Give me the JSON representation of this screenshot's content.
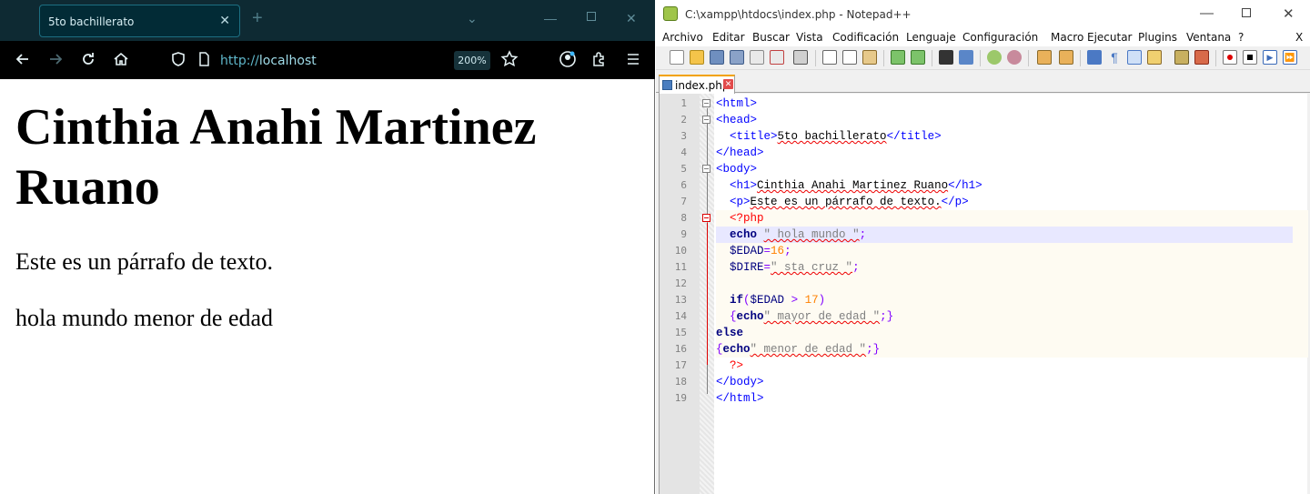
{
  "browser": {
    "tab_title": "5to bachillerato",
    "url_prefix": "http://",
    "url_host": "localhost",
    "zoom": "200%",
    "page": {
      "h1": "Cinthia Anahi Martinez Ruano",
      "paragraph": "Este es un párrafo de texto.",
      "output": "hola mundo menor de edad"
    }
  },
  "notepad": {
    "title": "C:\\xampp\\htdocs\\index.php - Notepad++",
    "menu": [
      "Archivo",
      "Editar",
      "Buscar",
      "Vista",
      "Codificación",
      "Lenguaje",
      "Configuración",
      "Macro",
      "Ejecutar",
      "Plugins",
      "Ventana",
      "?",
      "X"
    ],
    "file_tab": "index.php",
    "line_numbers": [
      "1",
      "2",
      "3",
      "4",
      "5",
      "6",
      "7",
      "8",
      "9",
      "10",
      "11",
      "12",
      "13",
      "14",
      "15",
      "16",
      "17",
      "18",
      "19"
    ],
    "code": {
      "l1": "<html>",
      "l2": "<head>",
      "l3_open": "<title>",
      "l3_text": "5to bachillerato",
      "l3_close": "</title>",
      "l4": "</head>",
      "l5": "<body>",
      "l6_open": "<h1>",
      "l6_text": "Cinthia Anahi Martinez Ruano",
      "l6_close": "</h1>",
      "l7_open": "<p>",
      "l7_text": "Este es un párrafo de texto.",
      "l7_close": "</p>",
      "l8": "<?php",
      "l9_kw": "echo",
      "l9_str": "\" hola mundo \"",
      "l9_end": ";",
      "l10_var": "$EDAD",
      "l10_op": "=",
      "l10_num": "16",
      "l10_end": ";",
      "l11_var": "$DIRE",
      "l11_op": "=",
      "l11_str": "\" sta cruz \"",
      "l11_end": ";",
      "l13_kw": "if",
      "l13_p1": "(",
      "l13_var": "$EDAD",
      "l13_op": " > ",
      "l13_num": "17",
      "l13_p2": ")",
      "l14_b1": "{",
      "l14_kw": "echo",
      "l14_str": "\" mayor de edad \"",
      "l14_end": ";}",
      "l15_kw": "else",
      "l16_b1": "{",
      "l16_kw": "echo",
      "l16_str": "\" menor de edad \"",
      "l16_end": ";}",
      "l17": "?>",
      "l18": "</body>",
      "l19": "</html>"
    }
  },
  "colors": {
    "browser_chrome": "#0e2a33",
    "accent_url": "#5fb6c9",
    "npp_active_tab": "#f2a200"
  }
}
